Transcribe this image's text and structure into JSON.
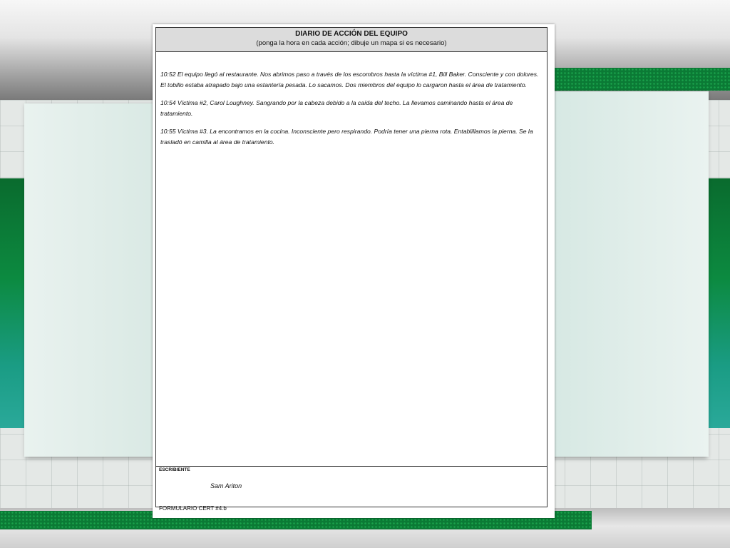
{
  "form": {
    "title": "DIARIO DE ACCIÓN DEL EQUIPO",
    "subtitle": "(ponga la hora en cada acción; dibuje un mapa si es necesario)",
    "entries": [
      "10:52 El equipo llegó al restaurante.  Nos abrimos paso a través de los escombros hasta la víctima #1, Bill Baker. Consciente y con dolores.  El tobillo estaba atrapado bajo una estantería pesada.  Lo sacamos.  Dos miembros del equipo lo cargaron hasta el área de tratamiento.",
      "10:54 Víctima #2, Carol Loughney.  Sangrando por la cabeza debido a la caída del techo.  La llevamos caminando hasta el área de tratamiento.",
      "10:55 Víctima #3.  La encontramos en la cocina.  Inconsciente pero respirando.  Podría tener una pierna rota. Entablillamos la pierna.  Se la trasladó en camilla al área de tratamiento."
    ],
    "scribe_label": "ESCRIBIENTE",
    "scribe_name": "Sam Ariton",
    "form_id": "FORMULARIO CERT #4.b"
  }
}
